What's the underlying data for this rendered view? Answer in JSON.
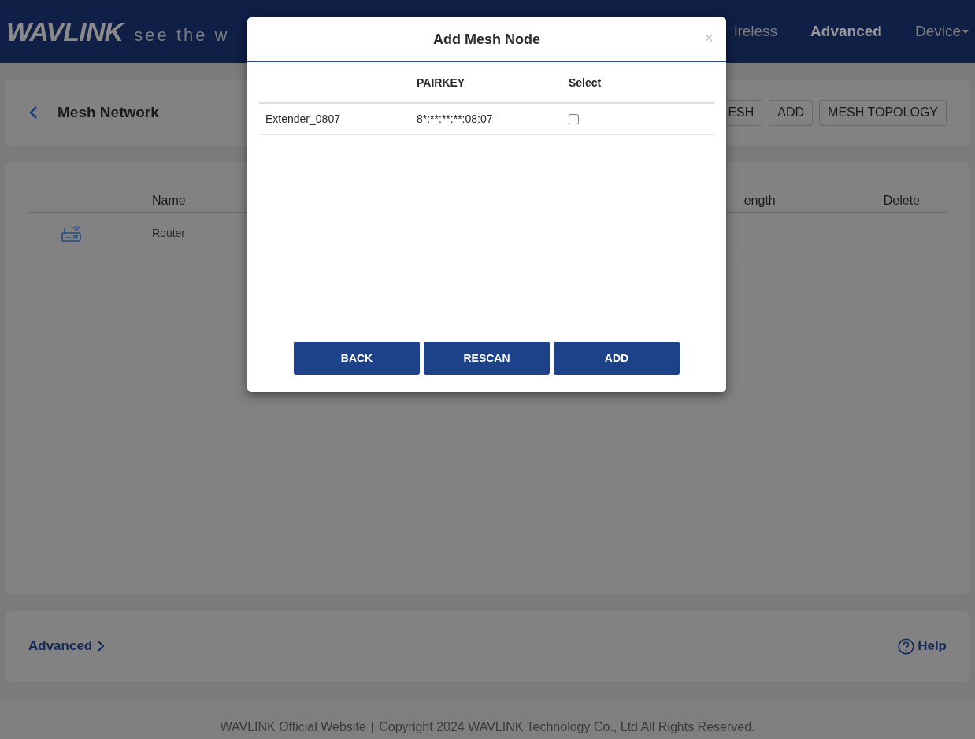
{
  "header": {
    "logo": "WAVLINK",
    "slogan": "see the w",
    "nav": [
      {
        "label": "ireless",
        "selected": false,
        "dropdown": false
      },
      {
        "label": "Advanced",
        "selected": true,
        "dropdown": false
      },
      {
        "label": "Device",
        "selected": false,
        "dropdown": true
      }
    ]
  },
  "page": {
    "title": "Mesh Network",
    "buttons": [
      "ESH",
      "ADD",
      "MESH TOPOLOGY"
    ],
    "table": {
      "columns": [
        "Name",
        "ength",
        "Delete"
      ],
      "rows": [
        {
          "name": "Router"
        }
      ]
    },
    "advanced_link": "Advanced",
    "help_link": "Help"
  },
  "footer": {
    "website": "WAVLINK Official Website",
    "separator": "|",
    "copyright": "Copyright 2024 WAVLINK Technology Co., Ltd All Rights Reserved."
  },
  "dialog": {
    "title": "Add Mesh Node",
    "close": "×",
    "columns": [
      "PAIRKEY",
      "Select"
    ],
    "rows": [
      {
        "name": "Extender_0807",
        "pairkey": "8*:**:**:**:08:07",
        "checked": false
      }
    ],
    "buttons": [
      "BACK",
      "RESCAN",
      "ADD"
    ]
  }
}
